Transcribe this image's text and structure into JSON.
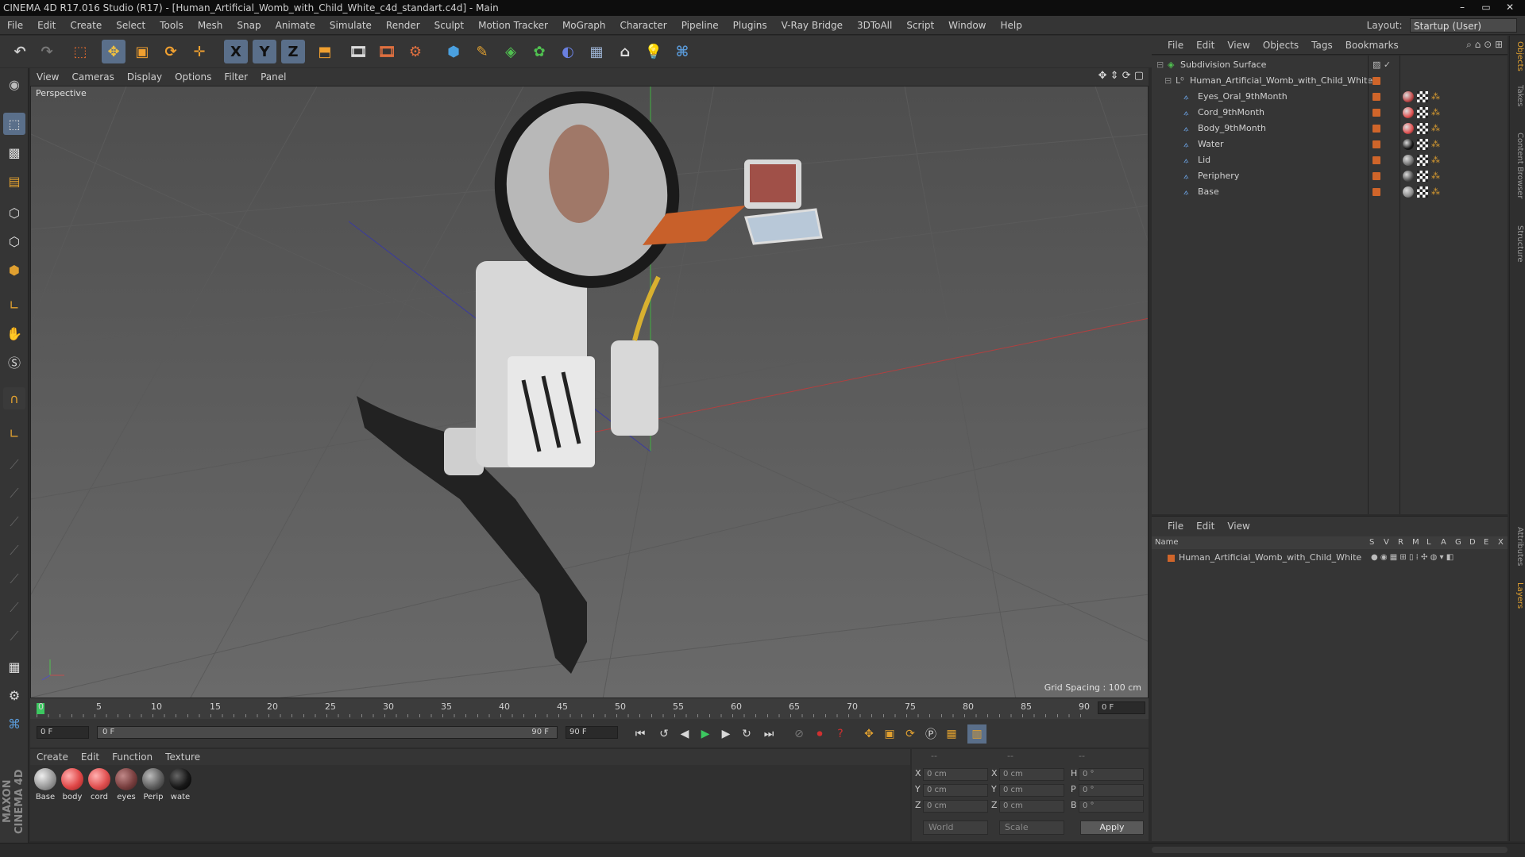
{
  "app": {
    "title": "CINEMA 4D R17.016 Studio (R17) - [Human_Artificial_Womb_with_Child_White_c4d_standart.c4d] - Main"
  },
  "window_buttons": [
    "–",
    "▭",
    "✕"
  ],
  "menubar": {
    "items": [
      "File",
      "Edit",
      "Create",
      "Select",
      "Tools",
      "Mesh",
      "Snap",
      "Animate",
      "Simulate",
      "Render",
      "Sculpt",
      "Motion Tracker",
      "MoGraph",
      "Character",
      "Pipeline",
      "Plugins",
      "V-Ray Bridge",
      "3DToAll",
      "Script",
      "Window",
      "Help"
    ],
    "layout_label": "Layout:",
    "layout_value": "Startup (User)"
  },
  "toolbar": {
    "icons": [
      "undo-icon",
      "redo-icon",
      "select-live-icon",
      "move-icon",
      "scale-icon",
      "rotate-icon",
      "add-icon",
      "x-axis-icon",
      "y-axis-icon",
      "z-axis-icon",
      "coordinate-system-icon",
      "render-view-icon",
      "render-picture-viewer-icon",
      "edit-render-settings-icon",
      "cube-icon",
      "pen-icon",
      "subdivision-icon",
      "array-icon",
      "deformer-icon",
      "floor-icon",
      "camera-icon",
      "light-icon",
      "python-icon"
    ],
    "axis_labels": [
      "X",
      "Y",
      "Z"
    ]
  },
  "viewport": {
    "menu": [
      "View",
      "Cameras",
      "Display",
      "Options",
      "Filter",
      "Panel"
    ],
    "label": "Perspective",
    "grid_spacing": "Grid Spacing : 100 cm"
  },
  "timeline": {
    "ticks": [
      "0",
      "5",
      "10",
      "15",
      "20",
      "25",
      "30",
      "35",
      "40",
      "45",
      "50",
      "55",
      "60",
      "65",
      "70",
      "75",
      "80",
      "85",
      "90"
    ],
    "current_frame": "0 F",
    "start_field": "0 F",
    "range_start": "0 F",
    "range_end": "90 F",
    "end_field": "90 F"
  },
  "material_manager": {
    "menu": [
      "Create",
      "Edit",
      "Function",
      "Texture"
    ],
    "materials": [
      {
        "label": "Base",
        "color": "#9a9a9a"
      },
      {
        "label": "body",
        "color": "#e04848"
      },
      {
        "label": "cord",
        "color": "#e05050"
      },
      {
        "label": "eyes",
        "color": "#7a4040"
      },
      {
        "label": "Perip",
        "color": "#606060"
      },
      {
        "label": "wate",
        "color": "#181818"
      }
    ]
  },
  "coordinates": {
    "header": [
      "--",
      "--",
      "--"
    ],
    "rows": [
      {
        "a": "X",
        "av": "0 cm",
        "b": "X",
        "bv": "0 cm",
        "c": "H",
        "cv": "0 °"
      },
      {
        "a": "Y",
        "av": "0 cm",
        "b": "Y",
        "bv": "0 cm",
        "c": "P",
        "cv": "0 °"
      },
      {
        "a": "Z",
        "av": "0 cm",
        "b": "Z",
        "bv": "0 cm",
        "c": "B",
        "cv": "0 °"
      }
    ],
    "mode": "World",
    "scale": "Scale",
    "apply": "Apply"
  },
  "object_manager": {
    "menu": [
      "File",
      "Edit",
      "View",
      "Objects",
      "Tags",
      "Bookmarks"
    ],
    "objects": [
      {
        "name": "Subdivision Surface",
        "level": 0,
        "tag_color": ""
      },
      {
        "name": "Human_Artificial_Womb_with_Child_White",
        "level": 1,
        "tag_color": ""
      },
      {
        "name": "Eyes_Oral_9thMonth",
        "level": 2,
        "tag_color": "#c04848"
      },
      {
        "name": "Cord_9thMonth",
        "level": 2,
        "tag_color": "#e05050"
      },
      {
        "name": "Body_9thMonth",
        "level": 2,
        "tag_color": "#e05050"
      },
      {
        "name": "Water",
        "level": 2,
        "tag_color": "#151515"
      },
      {
        "name": "Lid",
        "level": 2,
        "tag_color": "#707070"
      },
      {
        "name": "Periphery",
        "level": 2,
        "tag_color": "#505050"
      },
      {
        "name": "Base",
        "level": 2,
        "tag_color": "#8a8a8a"
      }
    ]
  },
  "layer_manager": {
    "menu": [
      "File",
      "Edit",
      "View"
    ],
    "columns": [
      "Name",
      "S",
      "V",
      "R",
      "M",
      "L",
      "A",
      "G",
      "D",
      "E",
      "X"
    ],
    "layer_name": "Human_Artificial_Womb_with_Child_White"
  },
  "side_tabs": [
    "Objects",
    "Takes",
    "Content Browser",
    "Structure",
    "Attributes",
    "Layers"
  ],
  "brand": "MAXON CINEMA 4D"
}
